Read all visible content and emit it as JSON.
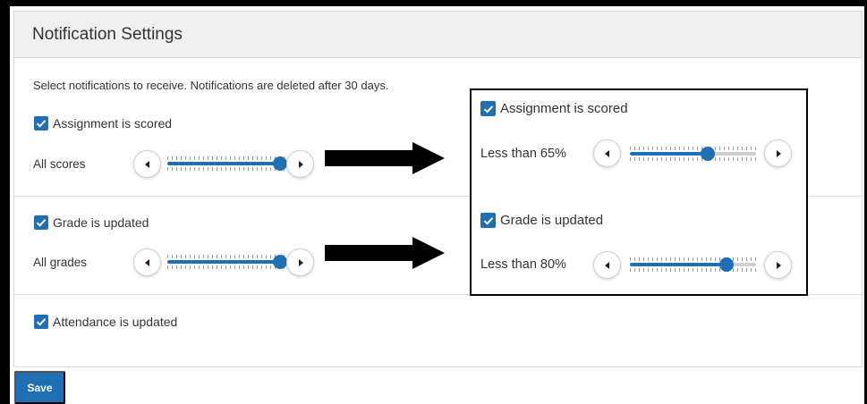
{
  "header": {
    "title": "Notification Settings"
  },
  "intro_text": "Select notifications to receive. Notifications are deleted after 30 days.",
  "assignment": {
    "label": "Assignment is scored",
    "checked": true,
    "level_label": "All scores",
    "slider_fraction": 1.0
  },
  "grade": {
    "label": "Grade is updated",
    "checked": true,
    "level_label": "All grades",
    "slider_fraction": 1.0
  },
  "attendance": {
    "label": "Attendance is updated",
    "checked": true
  },
  "callout": {
    "assignment": {
      "label": "Assignment is scored",
      "checked": true,
      "level_label": "Less than 65%",
      "slider_fraction": 0.63
    },
    "grade": {
      "label": "Grade is updated",
      "checked": true,
      "level_label": "Less than 80%",
      "slider_fraction": 0.8
    }
  },
  "save_label": "Save",
  "colors": {
    "accent": "#1f6fb5",
    "header_bg": "#f0f0f0",
    "frame": "#000000"
  },
  "icons": [
    "checkbox-checked-icon",
    "caret-left-icon",
    "caret-right-icon",
    "arrow-right-icon"
  ]
}
